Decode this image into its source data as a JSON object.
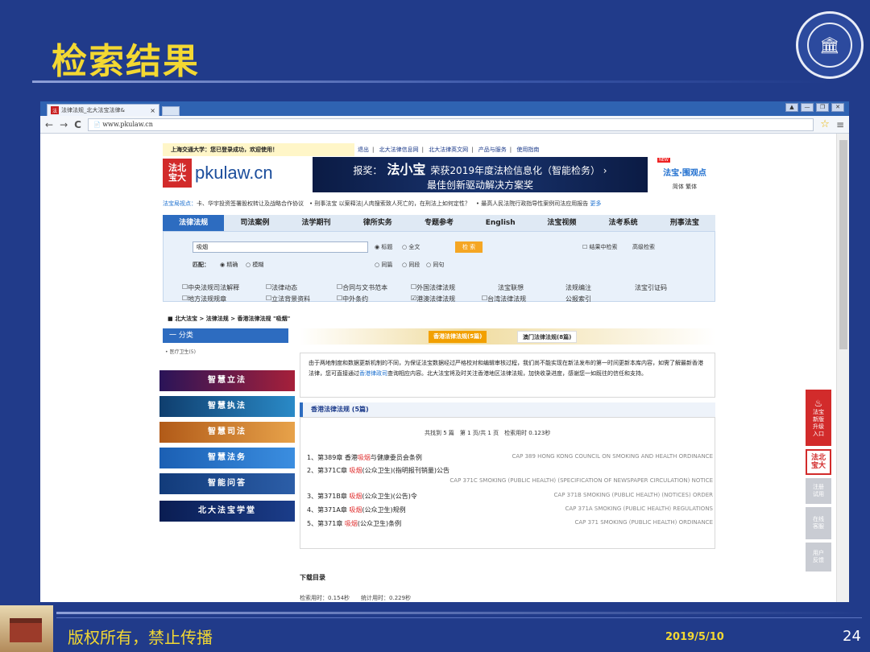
{
  "slide": {
    "title": "检索结果",
    "footer_text": "版权所有，禁止传播",
    "date": "2019/5/10",
    "page_number": "24",
    "logo_glyph": "🏛"
  },
  "browser": {
    "tab_title": "法律法规_北大法宝法律&",
    "tab_favicon": "法",
    "close": "×",
    "url": "www.pkulaw.cn",
    "window_buttons": [
      "▲",
      "—",
      "❐",
      "✕"
    ],
    "back": "←",
    "forward": "→",
    "reload": "C",
    "page_icon": "📄",
    "star": "☆",
    "menu": "≡"
  },
  "site": {
    "welcome": "上海交通大学：您已登录成功，欢迎使用！",
    "top_links": [
      "退出",
      "北大法律信息网",
      "北大法律英文网",
      "产品与服务",
      "使用指南"
    ],
    "brand_seal": "法北\n宝大",
    "brand_name": "pkulaw.cn",
    "banner_prefix": "报奖：",
    "banner_name": "法小宝",
    "banner_line1": "荣获2019年度法检信息化（智能检务）",
    "banner_line2": "最佳创新驱动解决方案奖",
    "side_new": "NEW",
    "side_brand": "法宝·围观点",
    "side_lang": "简体 繁体",
    "ticker_label": "法宝局视点：",
    "ticker_text": "卡、华宇投资签署股权转让及战略合作协议　•  刑事法宝 以案释法|人肉搜索致人死亡的，在刑法上如何定性？　•  最高人民法院行政指导性案例司法应用报告",
    "ticker_more": "更多",
    "nav": [
      "法律法规",
      "司法案例",
      "法学期刊",
      "律所实务",
      "专题参考",
      "English",
      "法宝视频",
      "法考系统",
      "刑事法宝"
    ],
    "search_value": "吸烟",
    "search_scope": [
      "标题",
      "全文"
    ],
    "search_button": "检 索",
    "search_extra": [
      "结果中检索",
      "高级检索"
    ],
    "match_label": "匹配：",
    "match_opts": [
      "精确",
      "模糊"
    ],
    "match_opts2": [
      "同篇",
      "同段",
      "同句"
    ],
    "checks_row1": [
      "中央法规司法解释",
      "法律动态",
      "合同与文书范本",
      "外国法律法规",
      "法宝联想",
      "法规编注",
      "法宝引证码"
    ],
    "checks_row2": [
      "地方法规规章",
      "立法背景资料",
      "中外条约",
      "港澳法律法规",
      "台湾法律法规",
      "公报索引"
    ],
    "breadcrumb": "北大法宝 > 法律法规 > 香港法律法规 \"吸烟\"",
    "category_header": "一  分类",
    "category_item": "医疗卫生(5)",
    "result_tab1": "香港法律法规(5篇)",
    "result_tab2": "澳门法律法规(8篇)",
    "notice": "由于两地制度和数据更新机制的不同，为保证法宝数据经过严格校对和编辑审核过程，我们尚不能实现在新法发布的第一时间更新本库内容，如需了解最新香港法律，您可直接通过",
    "notice_link": "香港律政司",
    "notice_tail": "查询相应内容。北大法宝将及时关注香港地区法律法规，加快收录进度，感谢您一如既往的信任和支持。",
    "result_title": "香港法律法规 (5篇)",
    "count_text": "共找到 5 篇　第 1 页/共 1 页　检索用时 0.123秒",
    "results": [
      {
        "pre": "1、第389章 香港",
        "hl": "吸烟",
        "post": "与健康委员会条例",
        "en": "CAP 389 HONG KONG COUNCIL ON SMOKING AND HEALTH ORDINANCE"
      },
      {
        "pre": "2、第371C章 ",
        "hl": "吸烟",
        "post": "(公众卫生)(指明报刊销量)公告",
        "en": "CAP 371C SMOKING (PUBLIC HEALTH) (SPECIFICATION OF NEWSPAPER CIRCULATION) NOTICE"
      },
      {
        "pre": "3、第371B章 ",
        "hl": "吸烟",
        "post": "(公众卫生)(公告)令",
        "en": "CAP 371B SMOKING (PUBLIC HEALTH) (NOTICES) ORDER"
      },
      {
        "pre": "4、第371A章 ",
        "hl": "吸烟",
        "post": "(公众卫生)规例",
        "en": "CAP 371A SMOKING (PUBLIC HEALTH) REGULATIONS"
      },
      {
        "pre": "5、第371章 ",
        "hl": "吸烟",
        "post": "(公众卫生)条例",
        "en": "CAP 371 SMOKING (PUBLIC HEALTH) ORDINANCE"
      }
    ],
    "left_buttons": [
      "智慧立法",
      "智慧执法",
      "智慧司法",
      "智慧法务",
      "智能问答",
      "北大法宝学堂"
    ],
    "download": "下载目录",
    "timing": "检索用时：0.154秒　　统计用时：0.229秒",
    "float_buttons": [
      "法宝新版升级入口",
      "法北宝大",
      "注册试用",
      "在线客服",
      "用户反馈"
    ]
  }
}
